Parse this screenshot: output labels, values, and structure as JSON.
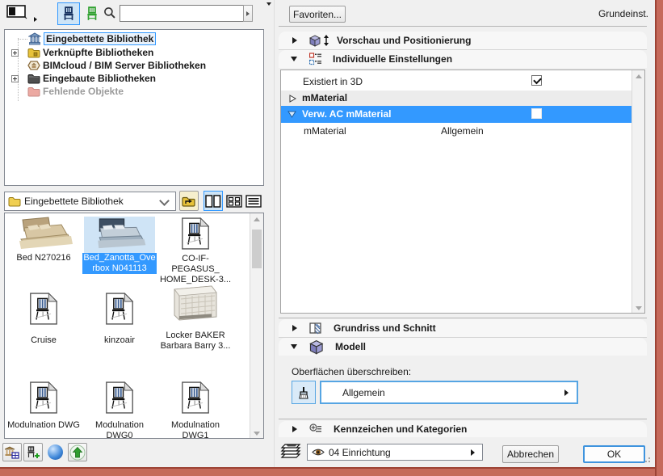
{
  "tree": {
    "items": [
      {
        "label": "Eingebettete Bibliothek"
      },
      {
        "label": "Verknüpfte Bibliotheken"
      },
      {
        "label": "BIMcloud / BIM Server Bibliotheken"
      },
      {
        "label": "Eingebaute Bibliotheken"
      },
      {
        "label": "Fehlende Objekte"
      }
    ]
  },
  "search": {
    "value": ""
  },
  "library_bar": {
    "combo_value": "Eingebettete Bibliothek"
  },
  "thumbnails": {
    "items": [
      {
        "line1": "Bed N270216",
        "line2": ""
      },
      {
        "line1": "Bed_Zanotta_Ove",
        "line2": "rbox N041113"
      },
      {
        "line1": "CO-IF-PEGASUS_",
        "line2": "HOME_DESK-3..."
      },
      {
        "line1": "Cruise",
        "line2": ""
      },
      {
        "line1": "kinzoair",
        "line2": ""
      },
      {
        "line1": "Locker BAKER",
        "line2": "Barbara Barry  3..."
      },
      {
        "line1": "Modulnation DWG",
        "line2": ""
      },
      {
        "line1": "Modulnation",
        "line2": "DWG0"
      },
      {
        "line1": "Modulnation",
        "line2": "DWG1"
      }
    ]
  },
  "right": {
    "favorites_button": "Favoriten...",
    "defaults_label": "Grundeinst.",
    "sections": {
      "preview": "Vorschau und Positionierung",
      "custom": "Individuelle Einstellungen",
      "plan": "Grundriss und Schnitt",
      "model": "Modell",
      "tags": "Kennzeichen und Kategorien"
    },
    "custom_settings": {
      "row_exists": "Existiert in 3D",
      "group_mmaterial": "mMaterial",
      "row_verw": "Verw. AC mMaterial",
      "row_mmaterial_label": "mMaterial",
      "row_mmaterial_value": "Allgemein"
    },
    "model_section": {
      "override_label": "Oberflächen überschreiben:",
      "surface_value": "Allgemein"
    },
    "footer": {
      "layer_value": "04 Einrichtung",
      "cancel": "Abbrechen",
      "ok": "OK"
    }
  },
  "colors": {
    "accent": "#3399ff",
    "frame": "#c66a5b"
  }
}
